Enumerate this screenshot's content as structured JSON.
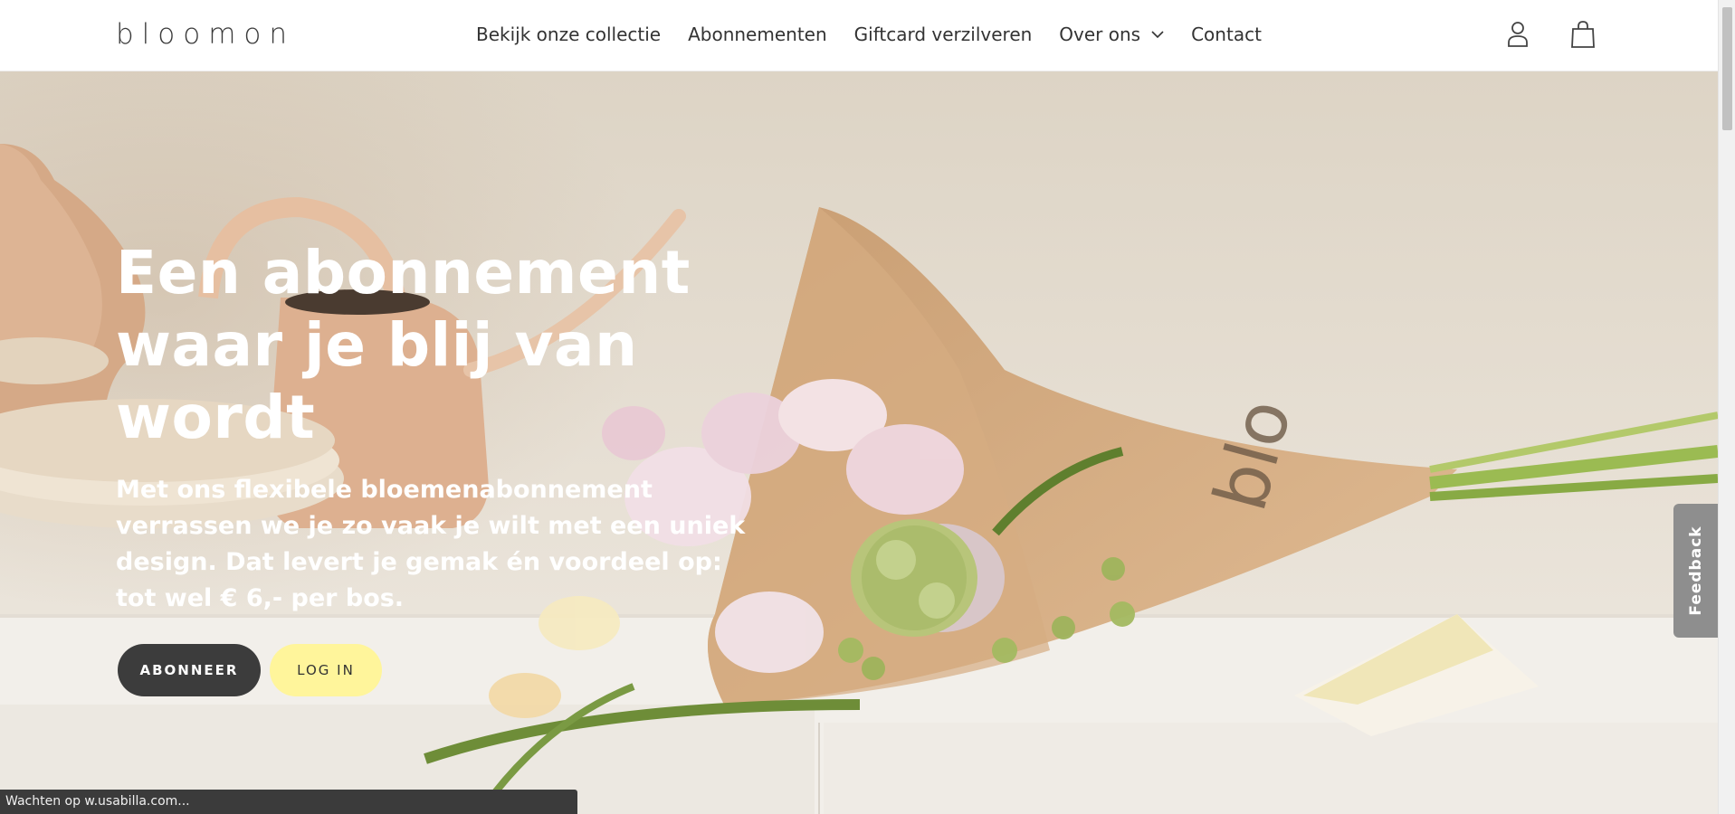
{
  "header": {
    "logo": "bloomon",
    "nav": [
      {
        "label": "Bekijk onze collectie"
      },
      {
        "label": "Abonnementen"
      },
      {
        "label": "Giftcard verzilveren"
      },
      {
        "label": "Over ons"
      },
      {
        "label": "Contact"
      }
    ],
    "icons": [
      "account-icon",
      "shopping-bag-icon"
    ]
  },
  "hero": {
    "title": "Een abonnement waar je blij van wordt",
    "subtitle": "Met ons flexibele bloemenabonnement verrassen we je zo vaak je wilt met een uniek design. Dat levert je gemak én voordeel op: tot wel € 6,- per bos.",
    "subscribe_label": "ABONNEER",
    "login_label": "LOG IN"
  },
  "feedback": {
    "label": "Feedback"
  },
  "statusbar": {
    "text": "Wachten op w.usabilla.com..."
  },
  "colors": {
    "button_dark": "#3c3c3c",
    "button_yellow": "#fff59b",
    "feedback_tab": "#8e8e8e"
  }
}
